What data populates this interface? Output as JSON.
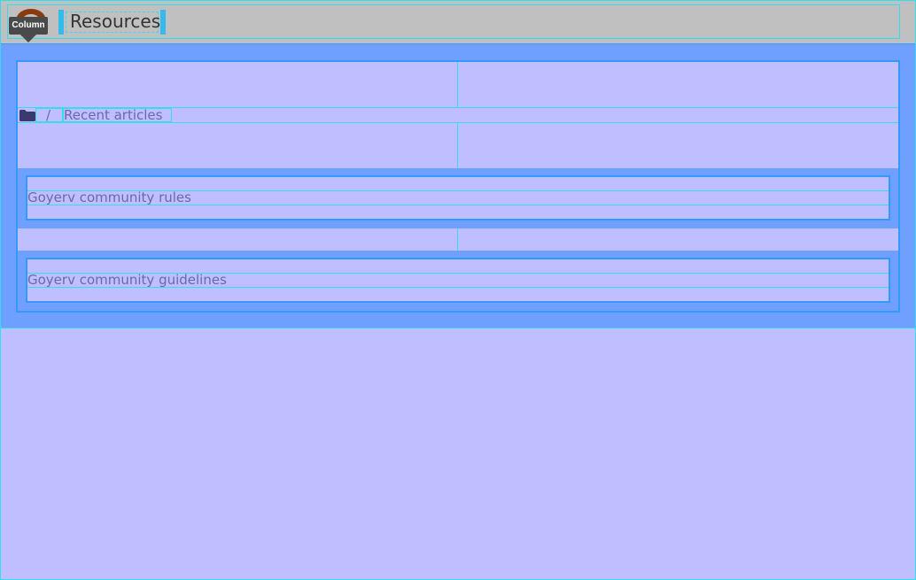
{
  "header": {
    "title": "Resources",
    "logo_icon": "chat-bubble-logo-icon",
    "tooltip_label": "Column"
  },
  "breadcrumb": {
    "icon": "folder-icon",
    "separator": "/",
    "current": "Recent articles"
  },
  "articles": [
    {
      "label": "Goyerv community rules"
    },
    {
      "label": "Goyerv community guidelines"
    }
  ],
  "colors": {
    "header_bg": "#c0c0c0",
    "page_bg": "#bfbfff",
    "panel_bg": "#6f9fff",
    "accent_border": "#3399ff",
    "guide_line": "#33ddee",
    "link_text": "#6a6aa8",
    "logo": "#8b3a0e"
  }
}
